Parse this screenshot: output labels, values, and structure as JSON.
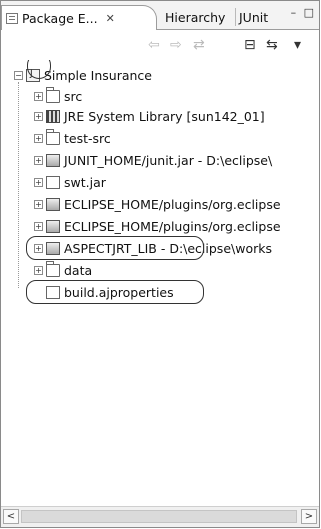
{
  "tabs": [
    {
      "label": "Package E...",
      "close": "✕"
    },
    {
      "label": "Hierarchy"
    },
    {
      "label": "JUnit"
    }
  ],
  "window_buttons": "– □",
  "toolbar": {
    "back": "⇦",
    "forward": "⇨",
    "link": "⇄",
    "collapse": "⊟",
    "sync": "⇆",
    "menu": "▾"
  },
  "tree": {
    "project": "Simple Insurance",
    "items": [
      {
        "label": "src"
      },
      {
        "label": "JRE System Library [sun142_01]"
      },
      {
        "label": "test-src"
      },
      {
        "label": "JUNIT_HOME/junit.jar - D:\\eclipse\\"
      },
      {
        "label": "swt.jar"
      },
      {
        "label": "ECLIPSE_HOME/plugins/org.eclipse"
      },
      {
        "label": "ECLIPSE_HOME/plugins/org.eclipse"
      },
      {
        "label": "ASPECTJRT_LIB - D:\\eclipse\\works"
      },
      {
        "label": "data"
      },
      {
        "label": "build.ajproperties"
      }
    ]
  },
  "scroll": {
    "left": "<",
    "right": ">"
  }
}
